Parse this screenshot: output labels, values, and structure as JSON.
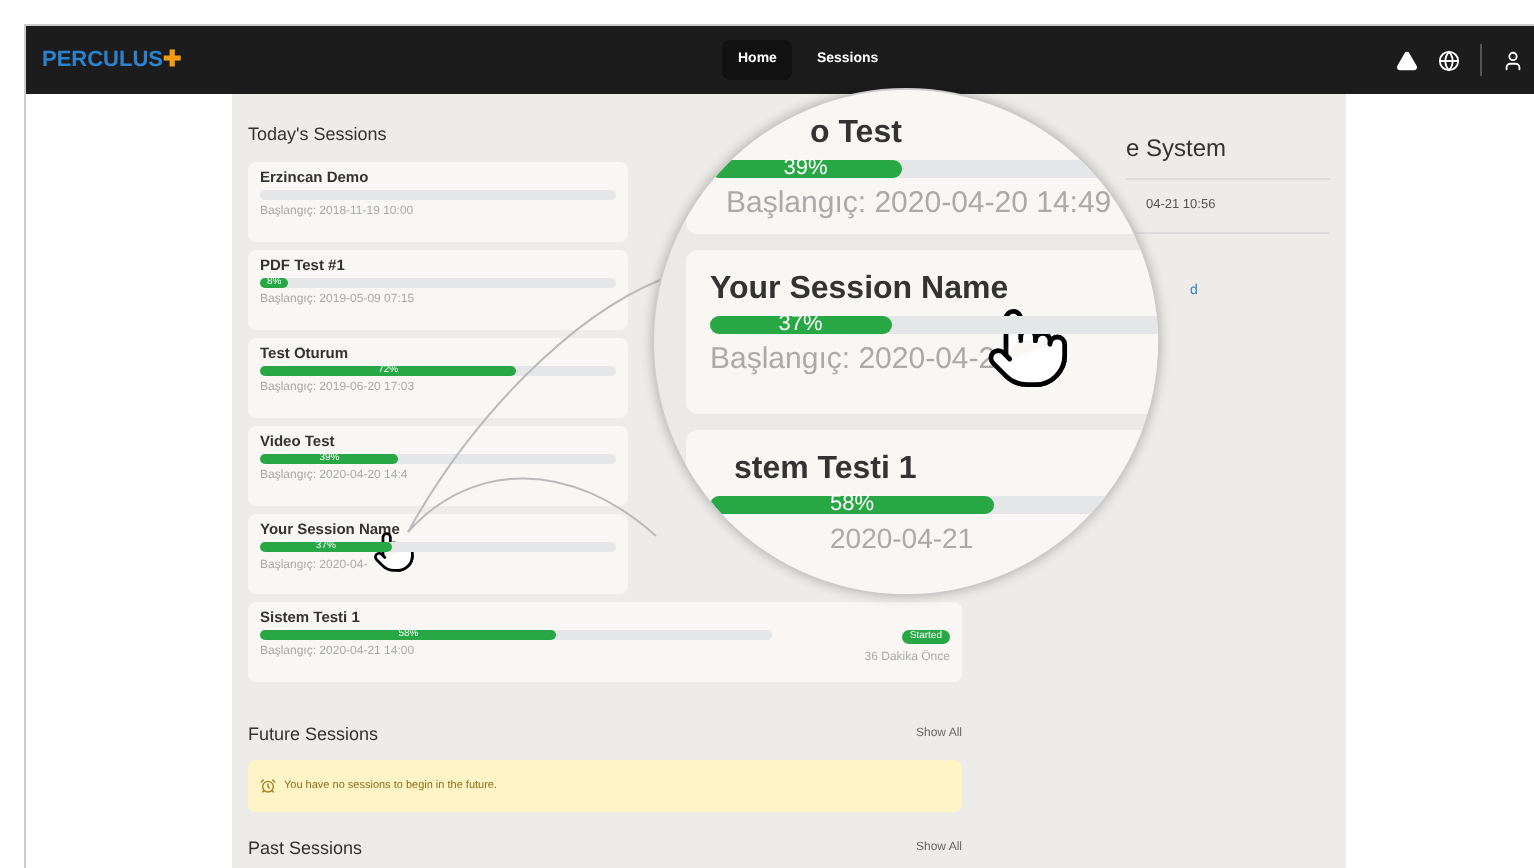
{
  "navbar": {
    "logo": "PERCULUS",
    "logo_mark": "✚",
    "nav": [
      {
        "label": "Home",
        "selected": true
      },
      {
        "label": "Sessions",
        "selected": false
      }
    ]
  },
  "today": {
    "title": "Today's Sessions",
    "sessions": [
      {
        "name": "Erzincan Demo",
        "level": 0,
        "date": "Başlangıç: 2018-11-19 10:00"
      },
      {
        "name": "PDF Test #1",
        "level": 0.08,
        "percent": "8%",
        "date": "Başlangıç: 2019-05-09 07:15"
      },
      {
        "name": "Test Oturum",
        "level": 0.72,
        "percent": "72%",
        "date": "Başlangıç: 2019-06-20 17:03"
      },
      {
        "name": "Video Test",
        "level": 0.39,
        "percent": "39%",
        "date": "Başlangıç: 2020-04-20 14:4"
      },
      {
        "name": "Your Session Name",
        "level": 0.37,
        "percent": "37%",
        "date": "Başlangıç: 2020-04-",
        "pointed": true
      },
      {
        "name": "Sistem Testi 1",
        "level": 0.58,
        "percent": "58%",
        "date": "Başlangıç: 2020-04-21 14:00",
        "badge": "Started",
        "ago": "36 Dakika Önce"
      }
    ]
  },
  "future": {
    "title": "Future Sessions",
    "show_all": "Show All",
    "notice": "You have no sessions to begin in the future."
  },
  "past": {
    "title": "Past Sessions",
    "show_all": "Show All"
  },
  "side_panel": {
    "title": "e System",
    "items": [
      "04-21 10:56"
    ],
    "link": "d"
  },
  "magnifier": {
    "sessions": [
      {
        "name": "o Test",
        "level": 0.39,
        "percent": "39%",
        "date": "Başlangıç: 2020-04-20 14:49"
      },
      {
        "name": "Your Session Name",
        "level": 0.37,
        "percent": "37%",
        "date": "Başlangıç: 2020-04-2",
        "pointed": true
      },
      {
        "name": "stem Testi 1",
        "level": 0.58,
        "percent": "58%",
        "date": "2020-04-21"
      }
    ]
  }
}
